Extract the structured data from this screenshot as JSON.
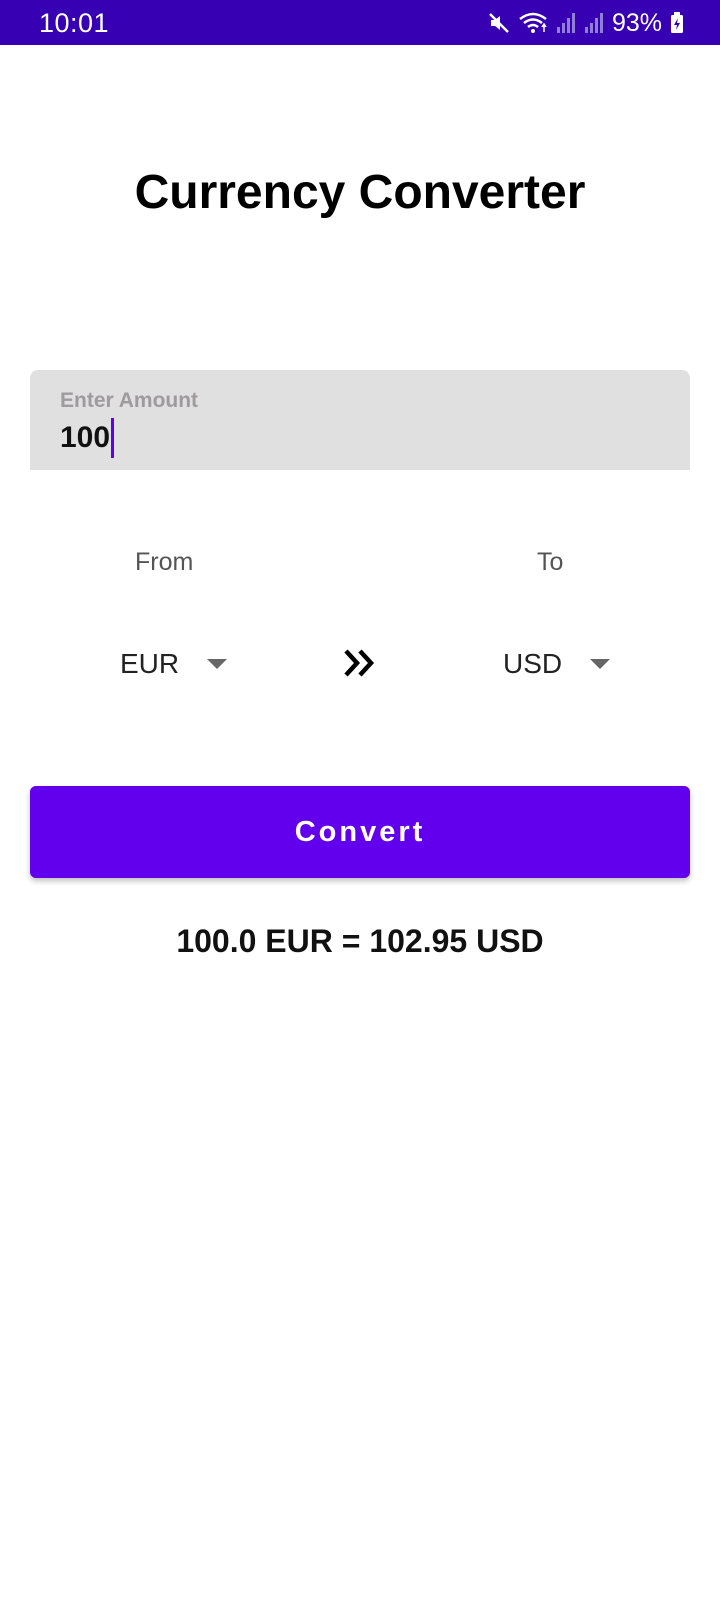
{
  "status_bar": {
    "time": "10:01",
    "battery_percent": "93%",
    "icons": [
      "mute-icon",
      "wifi-icon",
      "signal-icon",
      "signal-icon",
      "battery-charging-icon"
    ],
    "background_color": "#3700B3"
  },
  "app": {
    "title": "Currency Converter",
    "accent_color": "#6200EE"
  },
  "amount_field": {
    "label": "Enter Amount",
    "value": "100"
  },
  "conversion": {
    "from_label": "From",
    "to_label": "To",
    "from_currency": "EUR",
    "to_currency": "USD",
    "swap_icon": "double-chevron-right-icon"
  },
  "convert_button": {
    "label": "Convert"
  },
  "result": {
    "text": "100.0 EUR = 102.95 USD"
  }
}
